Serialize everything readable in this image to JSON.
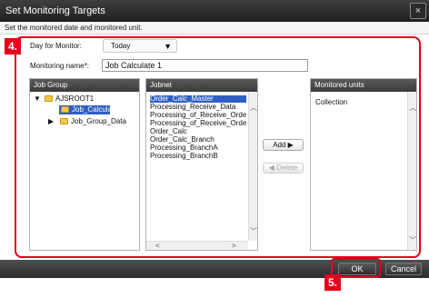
{
  "window": {
    "title": "Set Monitoring Targets",
    "close_label": "×",
    "instruction": "Set the monitored date and monitored unit."
  },
  "callouts": {
    "step4": "4.",
    "step5": "5."
  },
  "day_for_monitor": {
    "label": "Day for Monitor:",
    "value": "Today",
    "arrow": "▼"
  },
  "monitoring_name": {
    "label": "Monitoring name*:",
    "value": "Job Calculate 1"
  },
  "job_group": {
    "header": "Job Group",
    "tree": [
      {
        "label": "AJSROOT1",
        "expander": "▼"
      },
      {
        "label": "Job_Calculate",
        "selected": true
      },
      {
        "label": "Job_Group_Data",
        "expander": "▶"
      }
    ]
  },
  "jobnet": {
    "header": "Jobnet",
    "items": [
      "Order_Calc_Master",
      "Processing_Receive_Data",
      "Processing_of_Receive_Orde",
      "Processing_of_Receive_Orde",
      "Order_Calc",
      "Order_Calc_Branch",
      "Processing_BranchA",
      "Processing_BranchB"
    ],
    "selected_index": 0
  },
  "buttons": {
    "add": "Add",
    "add_arrow": "▶",
    "delete": "Delete",
    "delete_arrow": "◀"
  },
  "monitored_units": {
    "header": "Monitored units",
    "items": [
      "Collection"
    ]
  },
  "footer": {
    "ok": "OK",
    "cancel": "Cancel"
  },
  "colors": {
    "accent_red": "#e3001b",
    "selection": "#2f5fc4"
  }
}
